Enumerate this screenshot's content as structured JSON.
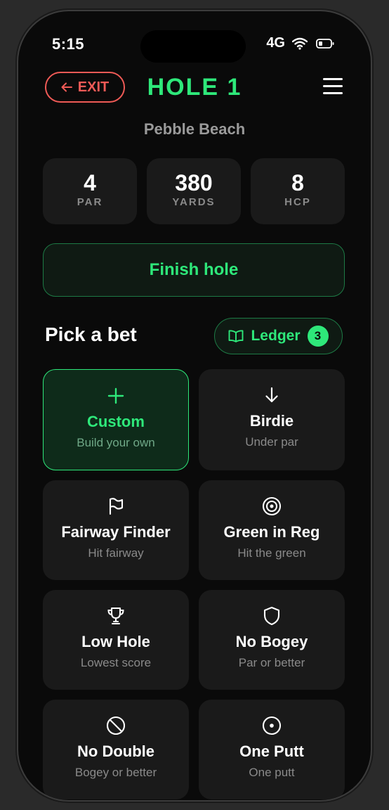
{
  "status": {
    "time": "5:15",
    "network": "4G"
  },
  "header": {
    "exit_label": "EXIT",
    "title": "HOLE 1"
  },
  "course": "Pebble Beach",
  "stats": [
    {
      "value": "4",
      "label": "PAR"
    },
    {
      "value": "380",
      "label": "YARDS"
    },
    {
      "value": "8",
      "label": "HCP"
    }
  ],
  "finish_label": "Finish hole",
  "pick_title": "Pick a bet",
  "ledger": {
    "label": "Ledger",
    "count": "3"
  },
  "bets": [
    {
      "icon": "plus-icon",
      "name": "Custom",
      "sub": "Build your own",
      "selected": true
    },
    {
      "icon": "arrow-down-icon",
      "name": "Birdie",
      "sub": "Under par"
    },
    {
      "icon": "flag-icon",
      "name": "Fairway Finder",
      "sub": "Hit fairway"
    },
    {
      "icon": "target-icon",
      "name": "Green in Reg",
      "sub": "Hit the green"
    },
    {
      "icon": "trophy-icon",
      "name": "Low Hole",
      "sub": "Lowest score"
    },
    {
      "icon": "shield-icon",
      "name": "No Bogey",
      "sub": "Par or better"
    },
    {
      "icon": "ban-icon",
      "name": "No Double",
      "sub": "Bogey or better"
    },
    {
      "icon": "circle-dot-icon",
      "name": "One Putt",
      "sub": "One putt"
    }
  ],
  "colors": {
    "accent": "#2ee87a",
    "danger": "#ef5a56",
    "background": "#0a0a0a",
    "card": "#1a1a1a"
  }
}
